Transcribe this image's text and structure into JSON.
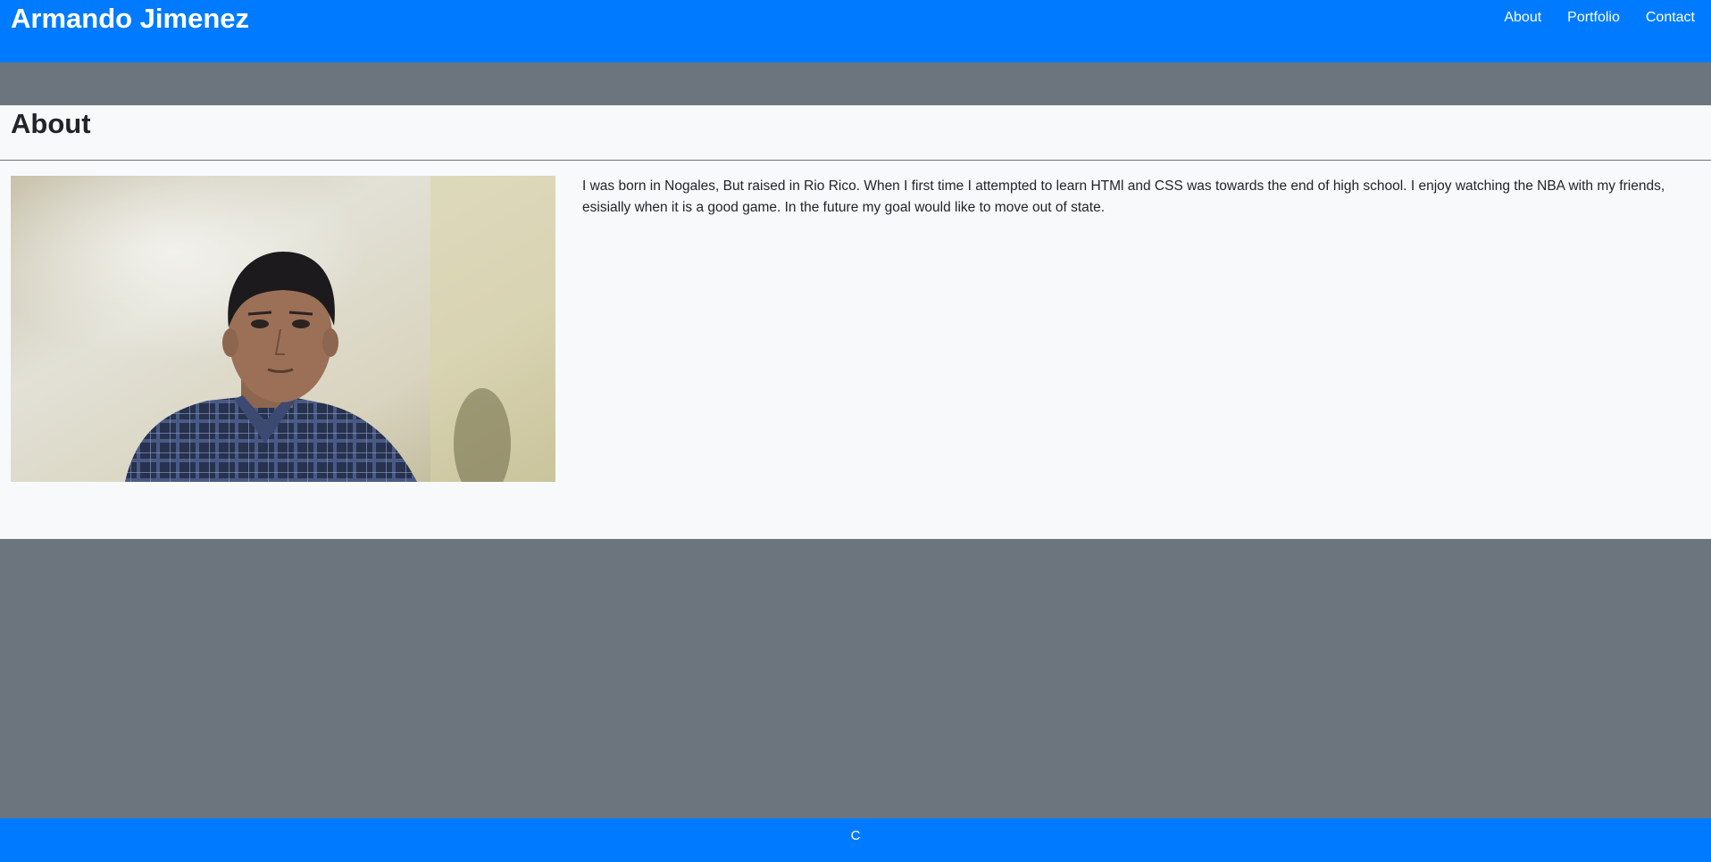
{
  "header": {
    "brand": "Armando Jimenez",
    "nav": [
      "About",
      "Portfolio",
      "Contact"
    ]
  },
  "about": {
    "title": "About",
    "bio": "I was born in Nogales, But raised in Rio Rico. When I first time I attempted to learn HTMl and CSS was towards the end of high school. I enjoy watching the NBA with my friends, esisially when it is a good game. In the future my goal would like to move out of state."
  },
  "footer": {
    "text": "C"
  },
  "colors": {
    "primary": "#007bff",
    "secondary": "#6c757d",
    "light": "#f8f9fa",
    "text": "#212529"
  }
}
